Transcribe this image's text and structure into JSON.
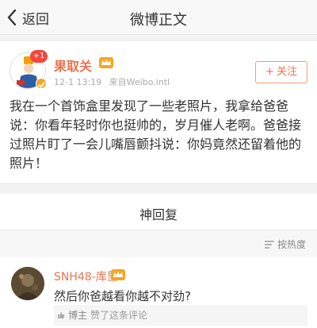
{
  "navbar": {
    "back_label": "返回",
    "title": "微博正文"
  },
  "post": {
    "username": "果取关",
    "plus_badge": "+1",
    "time": "12-1 13:19",
    "source": "来自Weibo.intl",
    "follow_label": "关注",
    "text": "我在一个首饰盒里发现了一些老照片，我拿给爸爸说：你看年轻时你也挺帅的，岁月催人老啊。爸爸接过照片盯了一会儿嘴唇颤抖说：你妈竟然还留着他的照片！"
  },
  "replies": {
    "title": "神回复",
    "sort_label": "按热度"
  },
  "comment": {
    "username": "SNH48-库里",
    "text": "然后你爸越看你越不对劲?",
    "blogger_label": "博主",
    "liked_label": "赞了这条评论"
  },
  "colors": {
    "accent": "#eb7350",
    "badge": "#f5453d",
    "vip": "#f5a623"
  },
  "icons": [
    "back-chevron-icon",
    "vip-crown-icon",
    "verified-badge-icon",
    "sort-icon",
    "like-icon"
  ]
}
